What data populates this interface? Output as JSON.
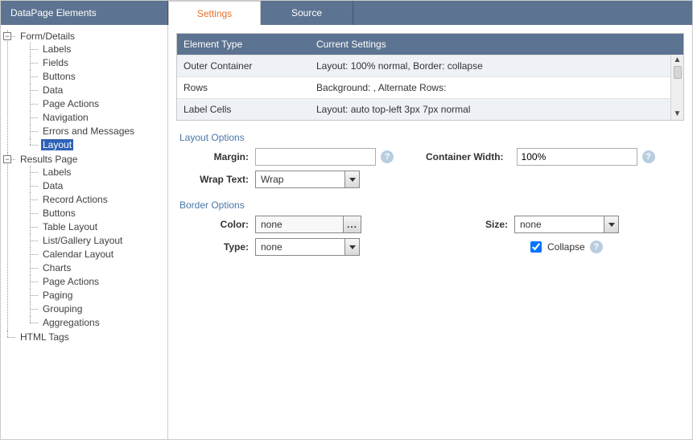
{
  "sidebar": {
    "title": "DataPage Elements",
    "groups": [
      {
        "label": "Form/Details",
        "items": [
          "Labels",
          "Fields",
          "Buttons",
          "Data",
          "Page Actions",
          "Navigation",
          "Errors and Messages",
          "Layout"
        ],
        "selected_index": 7
      },
      {
        "label": "Results Page",
        "items": [
          "Labels",
          "Data",
          "Record Actions",
          "Buttons",
          "Table Layout",
          "List/Gallery Layout",
          "Calendar Layout",
          "Charts",
          "Page Actions",
          "Paging",
          "Grouping",
          "Aggregations"
        ]
      },
      {
        "label": "HTML Tags",
        "items": []
      }
    ]
  },
  "tabs": {
    "settings": "Settings",
    "source": "Source"
  },
  "table": {
    "header": {
      "col1": "Element Type",
      "col2": "Current Settings"
    },
    "rows": [
      {
        "col1": "Outer Container",
        "col2": "Layout: 100% normal, Border: collapse"
      },
      {
        "col1": "Rows",
        "col2": "Background:     , Alternate Rows:"
      },
      {
        "col1": "Label Cells",
        "col2": "Layout: auto top-left 3px 7px normal"
      }
    ]
  },
  "sections": {
    "layout_title": "Layout Options",
    "border_title": "Border Options"
  },
  "layout": {
    "margin_label": "Margin:",
    "margin_value": "",
    "container_width_label": "Container Width:",
    "container_width_value": "100%",
    "wrap_label": "Wrap Text:",
    "wrap_value": "Wrap"
  },
  "border": {
    "color_label": "Color:",
    "color_value": "none",
    "color_btn": "...",
    "size_label": "Size:",
    "size_value": "none",
    "type_label": "Type:",
    "type_value": "none",
    "collapse_label": "Collapse",
    "collapse_checked": true
  }
}
